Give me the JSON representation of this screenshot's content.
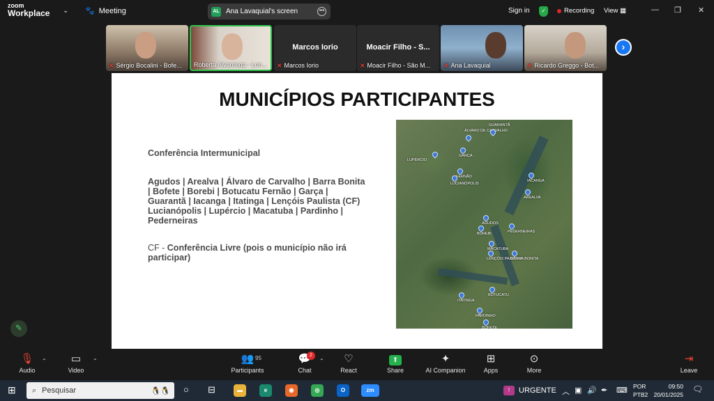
{
  "app": {
    "logo_line1": "zoom",
    "logo_line2": "Workplace",
    "meeting_label": "Meeting",
    "screen_share": "Ana Lavaquial's screen",
    "screen_initials": "AL",
    "sign_in": "Sign in",
    "recording": "Recording",
    "view": "View"
  },
  "participants": [
    {
      "name": "Sérgio Bocalini - Bofe...",
      "muted": true,
      "video": true
    },
    {
      "name": "Roberta Alvarenga - Len...",
      "muted": false,
      "video": true,
      "active": true
    },
    {
      "name": "Marcos Iorio",
      "display": "Marcos Iorio",
      "muted": true,
      "video": false
    },
    {
      "name": "Moacir Filho - São M...",
      "display": "Moacir Filho - S...",
      "muted": true,
      "video": false
    },
    {
      "name": "Ana Lavaquial",
      "muted": true,
      "video": true
    },
    {
      "name": "Ricardo Greggo - Bot...",
      "muted": true,
      "video": true
    }
  ],
  "slide": {
    "title": "MUNICÍPIOS PARTICIPANTES",
    "conference": "Conferência Intermunicipal",
    "cities": "Agudos | Arealva | Álvaro de Carvalho | Barra Bonita | Bofete | Borebi | Botucatu Fernão | Garça | Guarantã | Iacanga | Itatinga | Lençóis Paulista  (CF) Lucianópolis | Lupércio | Macatuba | Pardinho | Pederneiras",
    "cf_prefix": "CF - ",
    "cf_text": "Conferência Livre (pois o município não irá participar)",
    "map_labels": [
      "ÁLVARO DE CARVALHO",
      "GUARANTÃ",
      "GARÇA",
      "LUPÉRCIO",
      "FERNÃO",
      "LUCIANÓPOLIS",
      "IACANGA",
      "AREALVA",
      "AGUDOS",
      "BOREBI",
      "PEDERNEIRAS",
      "MACATUBA",
      "LENÇÓIS PAULISTA",
      "BARRA BONITA",
      "BOTUCATU",
      "ITATINGA",
      "PARDINHO",
      "BOFETE"
    ]
  },
  "toolbar": {
    "audio": "Audio",
    "video": "Video",
    "participants": "Participants",
    "participants_count": "95",
    "chat": "Chat",
    "chat_badge": "2",
    "react": "React",
    "share": "Share",
    "companion": "AI Companion",
    "apps": "Apps",
    "more": "More",
    "leave": "Leave"
  },
  "taskbar": {
    "search_placeholder": "Pesquisar",
    "urgent": "URGENTE",
    "lang1": "POR",
    "lang2": "PTB2",
    "time": "09:50",
    "date": "20/01/2025",
    "zm_label": "zm"
  },
  "colors": {
    "accent": "#2ec44d",
    "recording": "#e02828",
    "share": "#23b24b",
    "link_blue": "#1877f2"
  }
}
